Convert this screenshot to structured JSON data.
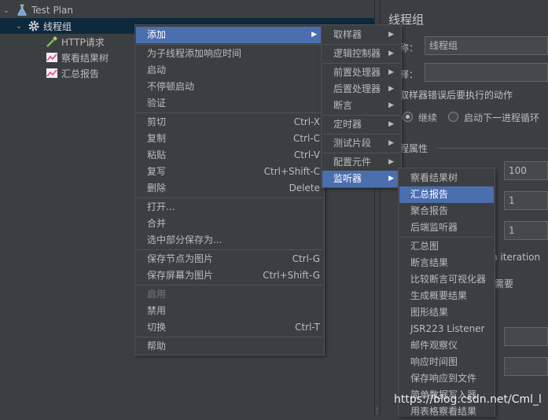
{
  "tree": {
    "test_plan": "Test Plan",
    "thread_group": "线程组",
    "http_request": "HTTP请求",
    "view_results_tree": "察看结果树",
    "summary_report": "汇总报告"
  },
  "right_panel": {
    "title": "线程组",
    "name_label": "称：",
    "name_value": "线程组",
    "comment_label": "释：",
    "error_section": "取样器错误后要执行的动作",
    "continue_label": "继续",
    "next_loop_label": "启动下一进程循环",
    "thread_props": "程属性",
    "threads_value": "100",
    "rampup_value": "1",
    "loop_value": "1",
    "iteration_text": "n iteration",
    "need_text": "需要"
  },
  "context_menu": {
    "items": [
      {
        "label": "添加",
        "submenu": "▶"
      },
      {
        "label": "为子线程添加响应时间"
      },
      {
        "label": "启动"
      },
      {
        "label": "不停顿启动"
      },
      {
        "label": "验证"
      },
      {
        "label": "剪切",
        "shortcut": "Ctrl-X"
      },
      {
        "label": "复制",
        "shortcut": "Ctrl-C"
      },
      {
        "label": "粘贴",
        "shortcut": "Ctrl-V"
      },
      {
        "label": "复写",
        "shortcut": "Ctrl+Shift-C"
      },
      {
        "label": "删除",
        "shortcut": "Delete"
      },
      {
        "label": "打开..."
      },
      {
        "label": "合并"
      },
      {
        "label": "选中部分保存为..."
      },
      {
        "label": "保存节点为图片",
        "shortcut": "Ctrl-G"
      },
      {
        "label": "保存屏幕为图片",
        "shortcut": "Ctrl+Shift-G"
      },
      {
        "label": "启用"
      },
      {
        "label": "禁用"
      },
      {
        "label": "切换",
        "shortcut": "Ctrl-T"
      },
      {
        "label": "帮助"
      }
    ]
  },
  "add_menu": {
    "items": [
      {
        "label": "取样器",
        "submenu": "▶"
      },
      {
        "label": "逻辑控制器",
        "submenu": "▶"
      },
      {
        "label": "前置处理器",
        "submenu": "▶"
      },
      {
        "label": "后置处理器",
        "submenu": "▶"
      },
      {
        "label": "断言",
        "submenu": "▶"
      },
      {
        "label": "定时器",
        "submenu": "▶"
      },
      {
        "label": "测试片段",
        "submenu": "▶"
      },
      {
        "label": "配置元件",
        "submenu": "▶"
      },
      {
        "label": "监听器",
        "submenu": "▶"
      }
    ]
  },
  "listener_menu": {
    "items": [
      {
        "label": "察看结果树"
      },
      {
        "label": "汇总报告"
      },
      {
        "label": "聚合报告"
      },
      {
        "label": "后端监听器"
      },
      {
        "label": "汇总图"
      },
      {
        "label": "断言结果"
      },
      {
        "label": "比较断言可视化器"
      },
      {
        "label": "生成概要结果"
      },
      {
        "label": "图形结果"
      },
      {
        "label": "JSR223 Listener"
      },
      {
        "label": "邮件观察仪"
      },
      {
        "label": "响应时间图"
      },
      {
        "label": "保存响应到文件"
      },
      {
        "label": "简单数据写入器"
      },
      {
        "label": "用表格察看结果"
      }
    ]
  },
  "watermark": "https://blog.csdn.net/Cml_l",
  "colors": {
    "background": "#3c3f41",
    "menu_highlight": "#4b6eaf",
    "tree_selected": "#0d293e",
    "text": "#bbbbbb"
  }
}
